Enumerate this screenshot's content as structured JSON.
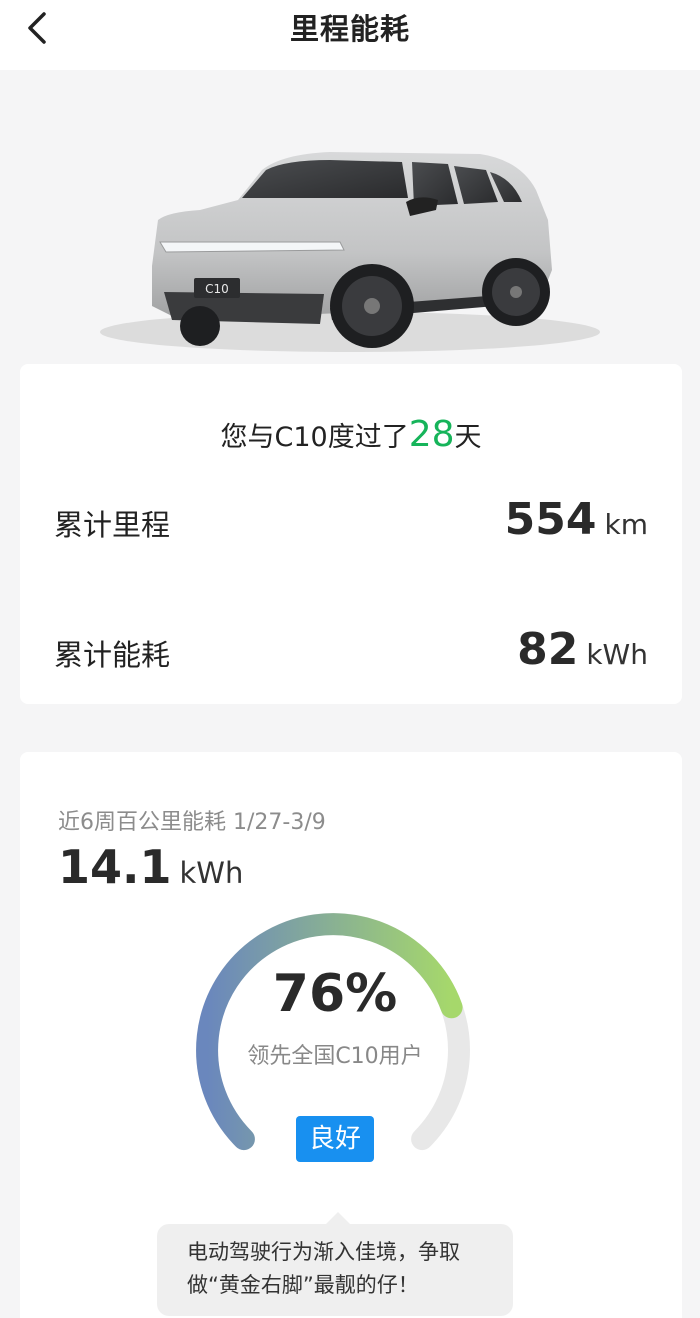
{
  "header": {
    "title": "里程能耗"
  },
  "car": {
    "model_badge": "C10",
    "body_color": "#c9cacb"
  },
  "summary": {
    "days_prefix": "您与C10度过了",
    "days_value": "28",
    "days_suffix": "天",
    "mileage_label": "累计里程",
    "mileage_value": "554",
    "mileage_unit": "km",
    "energy_label": "累计能耗",
    "energy_value": "82",
    "energy_unit": "kWh"
  },
  "efficiency": {
    "period_label": "近6周百公里能耗 1/27-3/9",
    "avg_value": "14.1",
    "avg_unit": "kWh",
    "percentile_text": "76%",
    "percentile": 0.76,
    "lead_text": "领先全国C10用户",
    "rating": "良好",
    "tip": "电动驾驶行为渐入佳境，争取做“黄金右脚”最靓的仔！"
  },
  "colors": {
    "accent_green": "#16b45a",
    "badge_blue": "#1890f0",
    "gauge_start": "#6a87bd",
    "gauge_end": "#a6d86b",
    "gauge_track": "#e8e8e8"
  },
  "icons": {
    "back": "chevron-left-icon"
  }
}
